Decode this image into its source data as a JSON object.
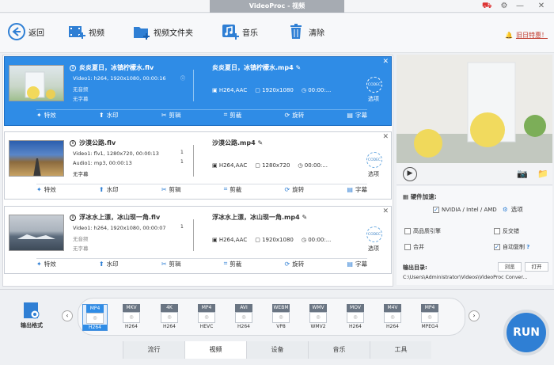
{
  "window": {
    "title": "VideoProc - 视频"
  },
  "toolbar": {
    "back": "返回",
    "video": "视频",
    "video_folder": "视频文件夹",
    "music": "音乐",
    "clear": "清除",
    "notice": "旧日特惠！"
  },
  "tasks": [
    {
      "name": "炎炎夏日，冰镇柠檬水.flv",
      "video_meta": "Video1: h264, 1920x1080, 00:00:16",
      "audio_meta": "无音频",
      "subtitle_meta": "无字幕",
      "out_name": "炎炎夏日，冰镇柠檬水.mp4",
      "out_codec": "H264,AAC",
      "out_res": "1920x1080",
      "out_time": "00:00:...",
      "badge": "CODEC",
      "option": "选项",
      "count1": "1",
      "count2": "1"
    },
    {
      "name": "沙漠公路.flv",
      "video_meta": "Video1: flv1, 1280x720, 00:00:13",
      "audio_meta": "Audio1: mp3, 00:00:13",
      "subtitle_meta": "无字幕",
      "out_name": "沙漠公路.mp4",
      "out_codec": "H264,AAC",
      "out_res": "1280x720",
      "out_time": "00:00:...",
      "badge": "CODEC",
      "option": "选项",
      "count1": "1",
      "count2": "1"
    },
    {
      "name": "浮冰水上漂，冰山现一角.flv",
      "video_meta": "Video1: h264, 1920x1080, 00:00:07",
      "audio_meta": "无音频",
      "subtitle_meta": "无字幕",
      "out_name": "浮冰水上漂，冰山现一角.mp4",
      "out_codec": "H264,AAC",
      "out_res": "1920x1080",
      "out_time": "00:00:...",
      "badge": "CODEC",
      "option": "选项",
      "count1": "1",
      "count2": ""
    }
  ],
  "actions": [
    "特效",
    "水印",
    "剪辑",
    "剪裁",
    "旋转",
    "字幕"
  ],
  "settings": {
    "hw_accel": "硬件加速:",
    "hw_option": "NVIDIA / Intel / AMD",
    "option_btn": "选项",
    "high_quality": "高品质引擎",
    "deinterlace": "反交错",
    "merge": "合并",
    "auto_copy": "自动复制",
    "help": "?",
    "output_dir": "输出目录:",
    "browse": "浏览",
    "open": "打开",
    "path": "C:\\Users\\Administrator\\Videos\\VideoProc Conver..."
  },
  "output_format_label": "输出格式",
  "formats": [
    {
      "top": "MP4",
      "bottom": "H264"
    },
    {
      "top": "MKV",
      "bottom": "H264"
    },
    {
      "top": "4K",
      "bottom": "H264"
    },
    {
      "top": "MP4",
      "bottom": "HEVC"
    },
    {
      "top": "AVI",
      "bottom": "H264"
    },
    {
      "top": "WEBM",
      "bottom": "VP8"
    },
    {
      "top": "WMV",
      "bottom": "WMV2"
    },
    {
      "top": "MOV",
      "bottom": "H264"
    },
    {
      "top": "M4V",
      "bottom": "H264"
    },
    {
      "top": "MP4",
      "bottom": "MPEG4"
    }
  ],
  "tabs": [
    "流行",
    "视频",
    "设备",
    "音乐",
    "工具"
  ],
  "run": "RUN",
  "colors": {
    "accent": "#2f8ce6",
    "selected_card": "#2f8ce6",
    "run": "#2f7fd4"
  }
}
